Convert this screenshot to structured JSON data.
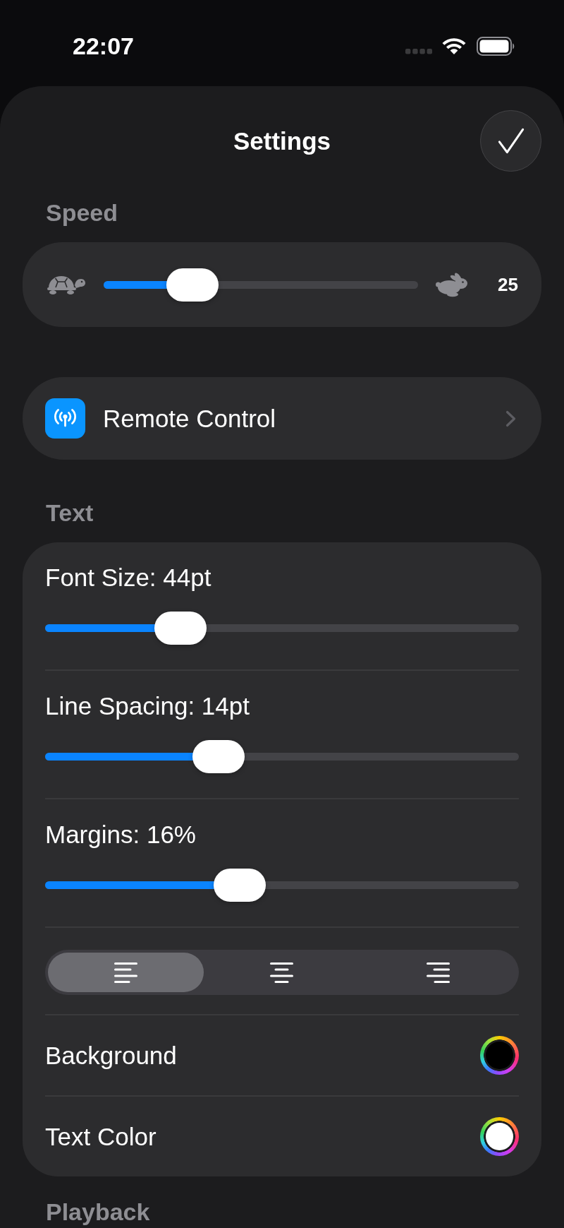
{
  "status_bar": {
    "time": "22:07"
  },
  "sheet": {
    "title": "Settings"
  },
  "speed": {
    "header": "Speed",
    "level": 0.24,
    "reading": "25"
  },
  "remote_control": {
    "label": "Remote Control"
  },
  "text": {
    "header": "Text",
    "sliders": [
      {
        "label": "Font Size: 44pt",
        "level": 0.26
      },
      {
        "label": "Line Spacing: 14pt",
        "level": 0.35
      },
      {
        "label": "Margins: 16%",
        "level": 0.4
      }
    ],
    "alignment": [
      {
        "kind": "left",
        "selected": true
      },
      {
        "kind": "center",
        "selected": false
      },
      {
        "kind": "right",
        "selected": false
      }
    ],
    "colors": [
      {
        "label": "Background",
        "color": "#000000"
      },
      {
        "label": "Text Color",
        "color": "#ffffff"
      }
    ]
  },
  "playback": {
    "header": "Playback"
  }
}
